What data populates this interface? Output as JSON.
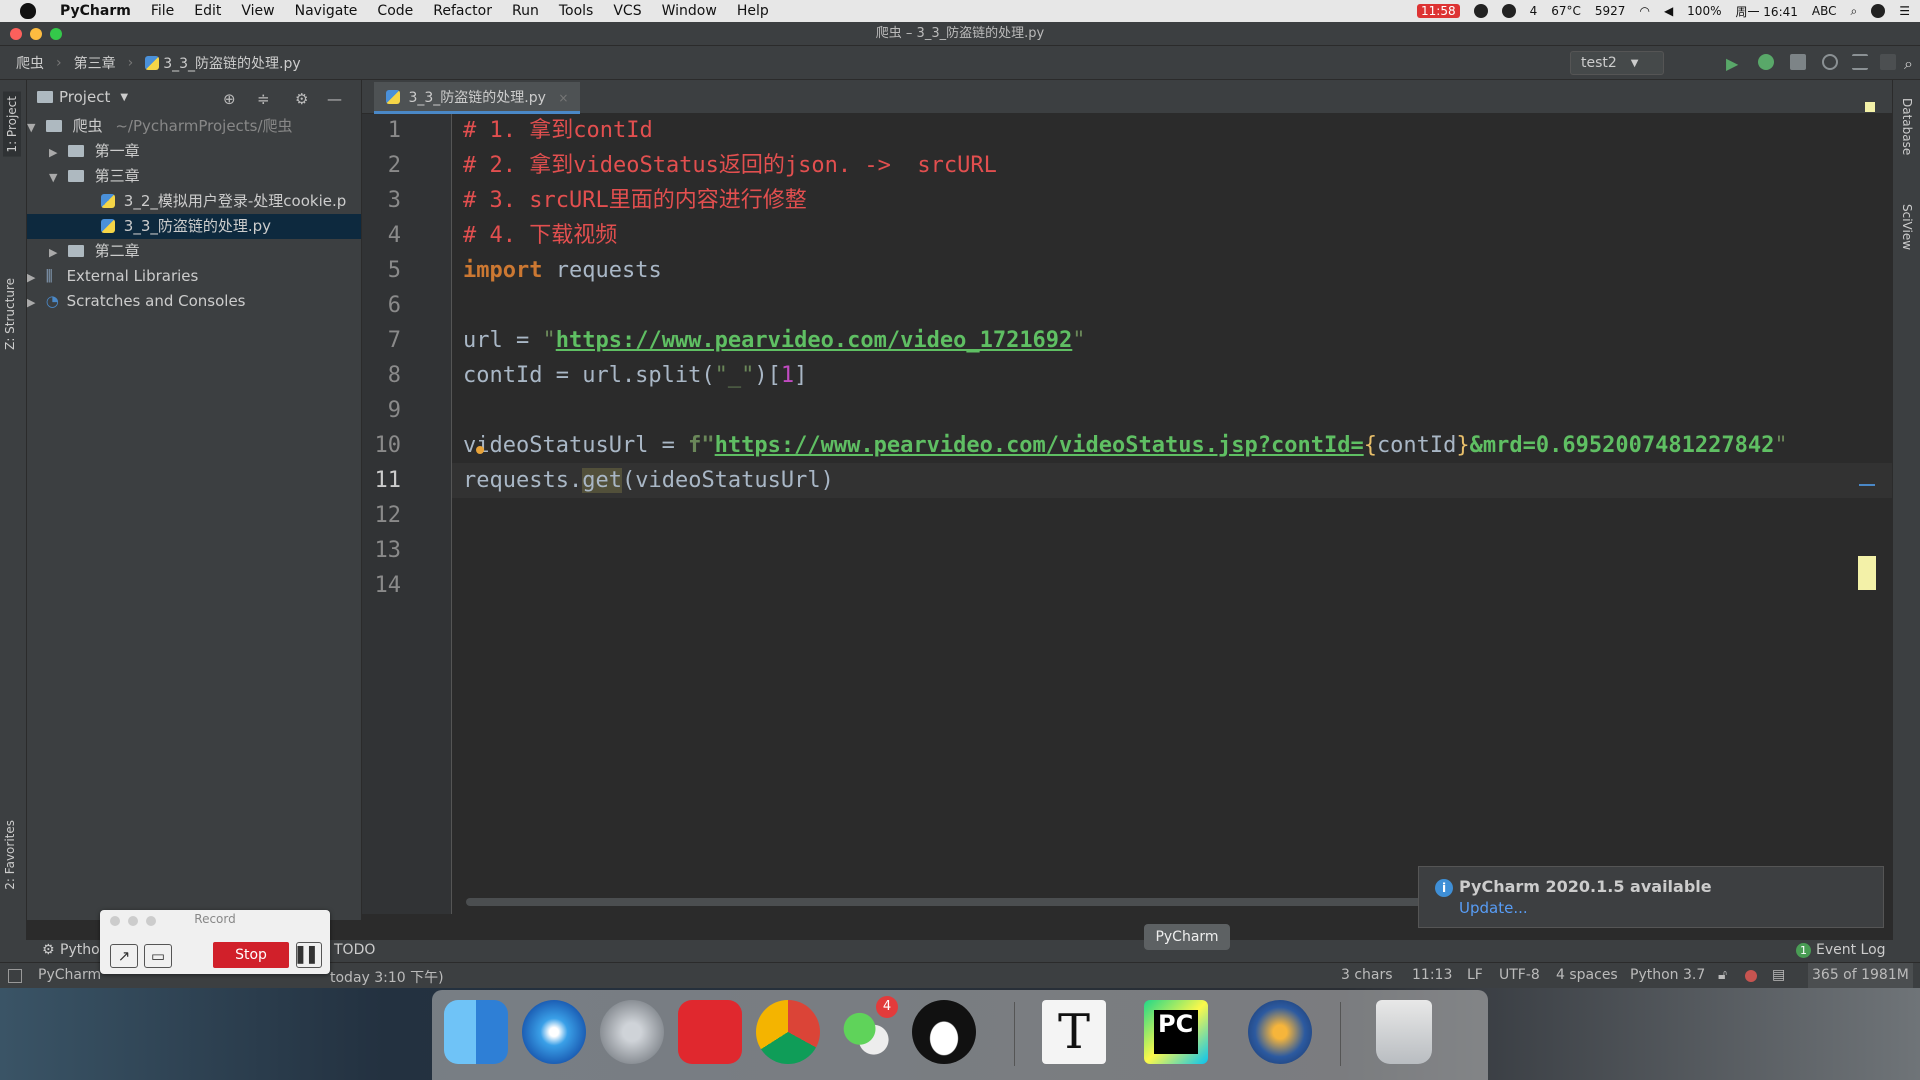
{
  "menubar": {
    "app": "PyCharm",
    "items": [
      "File",
      "Edit",
      "View",
      "Navigate",
      "Code",
      "Refactor",
      "Run",
      "Tools",
      "VCS",
      "Window",
      "Help"
    ],
    "status": {
      "recording_time": "11:58",
      "wechat_count": "4",
      "temperature": "67°C",
      "fan": "5927",
      "battery": "100%",
      "datetime": "周一 16:41",
      "input_method": "ABC"
    }
  },
  "window": {
    "title": "爬虫 – 3_3_防盗链的处理.py"
  },
  "breadcrumb": {
    "project": "爬虫",
    "folder": "第三章",
    "file": "3_3_防盗链的处理.py"
  },
  "run_config": {
    "label": "test2"
  },
  "left_stripe": {
    "project_tab": "1: Project",
    "structure_tab": "Z: Structure",
    "favorites_tab": "2: Favorites"
  },
  "right_stripe": {
    "database_tab": "Database",
    "sciview_tab": "SciView"
  },
  "project_panel": {
    "title": "Project",
    "tree": [
      {
        "label": "爬虫",
        "hint": "~/PycharmProjects/爬虫"
      },
      {
        "label": "第一章"
      },
      {
        "label": "第三章"
      },
      {
        "label": "3_2_模拟用户登录-处理cookie.p"
      },
      {
        "label": "3_3_防盗链的处理.py"
      },
      {
        "label": "第二章"
      },
      {
        "label": "External Libraries"
      },
      {
        "label": "Scratches and Consoles"
      }
    ]
  },
  "editor": {
    "tab_label": "3_3_防盗链的处理.py",
    "line_numbers": [
      "1",
      "2",
      "3",
      "4",
      "5",
      "6",
      "7",
      "8",
      "9",
      "10",
      "11",
      "12",
      "13",
      "14"
    ],
    "code": {
      "l1": "# 1. 拿到contId",
      "l2": "# 2. 拿到videoStatus返回的json. ->  srcURL",
      "l3": "# 3. srcURL里面的内容进行修整",
      "l4": "# 4. 下载视频",
      "l5_kw": "import",
      "l5_rest": " requests",
      "l7_a": "url = ",
      "l7_url": "https://www.pearvideo.com/video_1721692",
      "l8_a": "contId = url.split(",
      "l8_str": "\"_\"",
      "l8_b": ")[",
      "l8_num": "1",
      "l8_c": "]",
      "l10_a": "videoStatusUrl = ",
      "l10_f": "f\"",
      "l10_url": "https://www.pearvideo.com/videoStatus.jsp?contId=",
      "l10_var": "contId",
      "l10_rest": "&mrd=0.6952007481227842",
      "l11_a": "requests.",
      "l11_hl": "get",
      "l11_b": "(videoStatusUrl)"
    }
  },
  "notification": {
    "title": "PyCharm 2020.1.5 available",
    "link": "Update..."
  },
  "bottom_tools": {
    "python_console": "Pytho",
    "todo": "TODO",
    "event_log": "Event Log",
    "event_count": "1"
  },
  "statusbar": {
    "message": "PyCharm",
    "message_tail": "today 3:10 下午)",
    "chars": "3 chars",
    "position": "11:13",
    "line_sep": "LF",
    "encoding": "UTF-8",
    "indent": "4 spaces",
    "interpreter": "Python 3.7",
    "memory": "365 of 1981M"
  },
  "record_widget": {
    "title": "Record",
    "stop": "Stop"
  },
  "dock": {
    "tooltip": "PyCharm",
    "wechat_badge": "4",
    "typora_letter": "T",
    "pycharm_letters": "PC"
  },
  "colors": {
    "comment": "#e24f4f",
    "keyword": "#cc7832",
    "url": "#5fbf63",
    "string": "#6a8759",
    "number": "#c14bc1",
    "accent": "#4a88c7"
  }
}
